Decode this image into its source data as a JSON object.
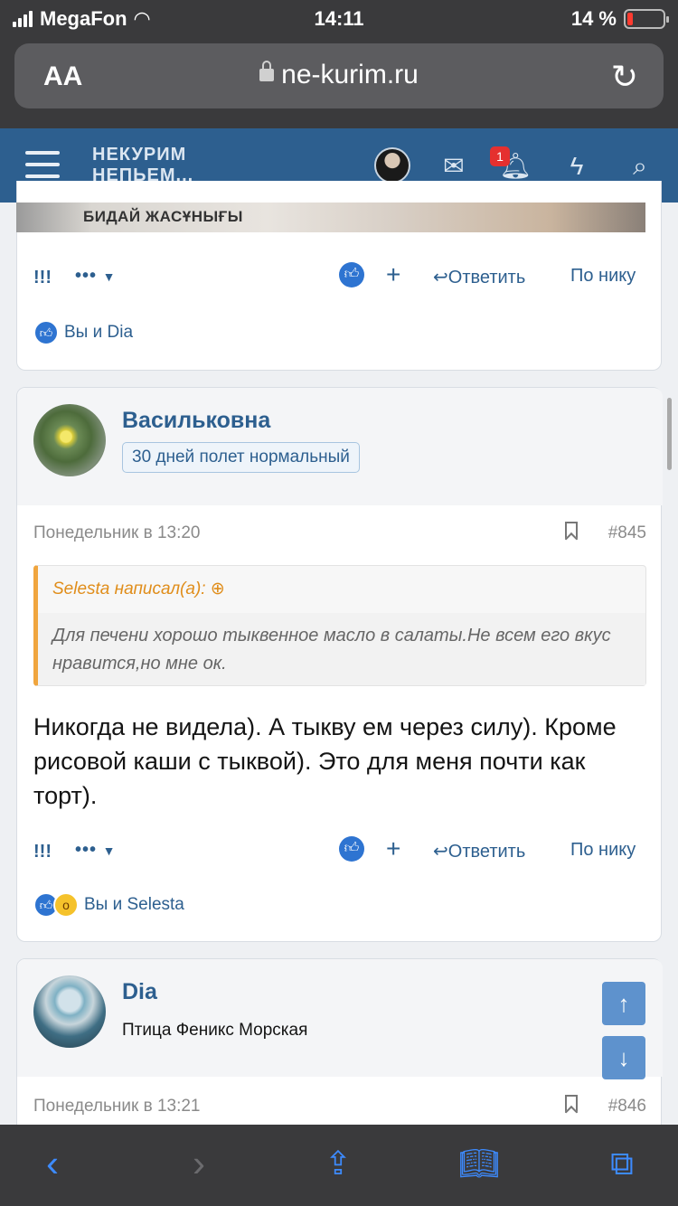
{
  "status_bar": {
    "carrier": "MegaFon",
    "time": "14:11",
    "battery": "14 %"
  },
  "browser": {
    "text_size_label": "AA",
    "url": "ne-kurim.ru"
  },
  "site_header": {
    "logo_line1": "НЕКУРИМ",
    "logo_line2": "НЕПЬЕМ...",
    "notification_count": "1"
  },
  "top_post": {
    "image_caption": "БИДАЙ ЖАСҰНЫҒЫ",
    "report": "!!!",
    "more": "•••",
    "plus": "+",
    "reply": "Ответить",
    "by_nick": "По нику",
    "reactions_text": "Вы и Dia"
  },
  "post_845": {
    "username": "Васильковна",
    "user_title": "30 дней полет нормальный",
    "date": "Понедельник в 13:20",
    "number": "#845",
    "quote_author": "Selesta написал(а):",
    "quote_text": "Для печени хорошо тыквенное масло в салаты.Не всем его вкус нравится,но мне ок.",
    "text": "Никогда не видела). А тыкву ем через силу). Кроме рисовой каши с тыквой). Это для меня почти как торт).",
    "report": "!!!",
    "more": "•••",
    "plus": "+",
    "reply": "Ответить",
    "by_nick": "По нику",
    "reactions_text": "Вы и Selesta"
  },
  "post_846": {
    "username": "Dia",
    "user_title": "Птица Феникс Морская",
    "date": "Понедельник в 13:21",
    "number": "#846"
  }
}
